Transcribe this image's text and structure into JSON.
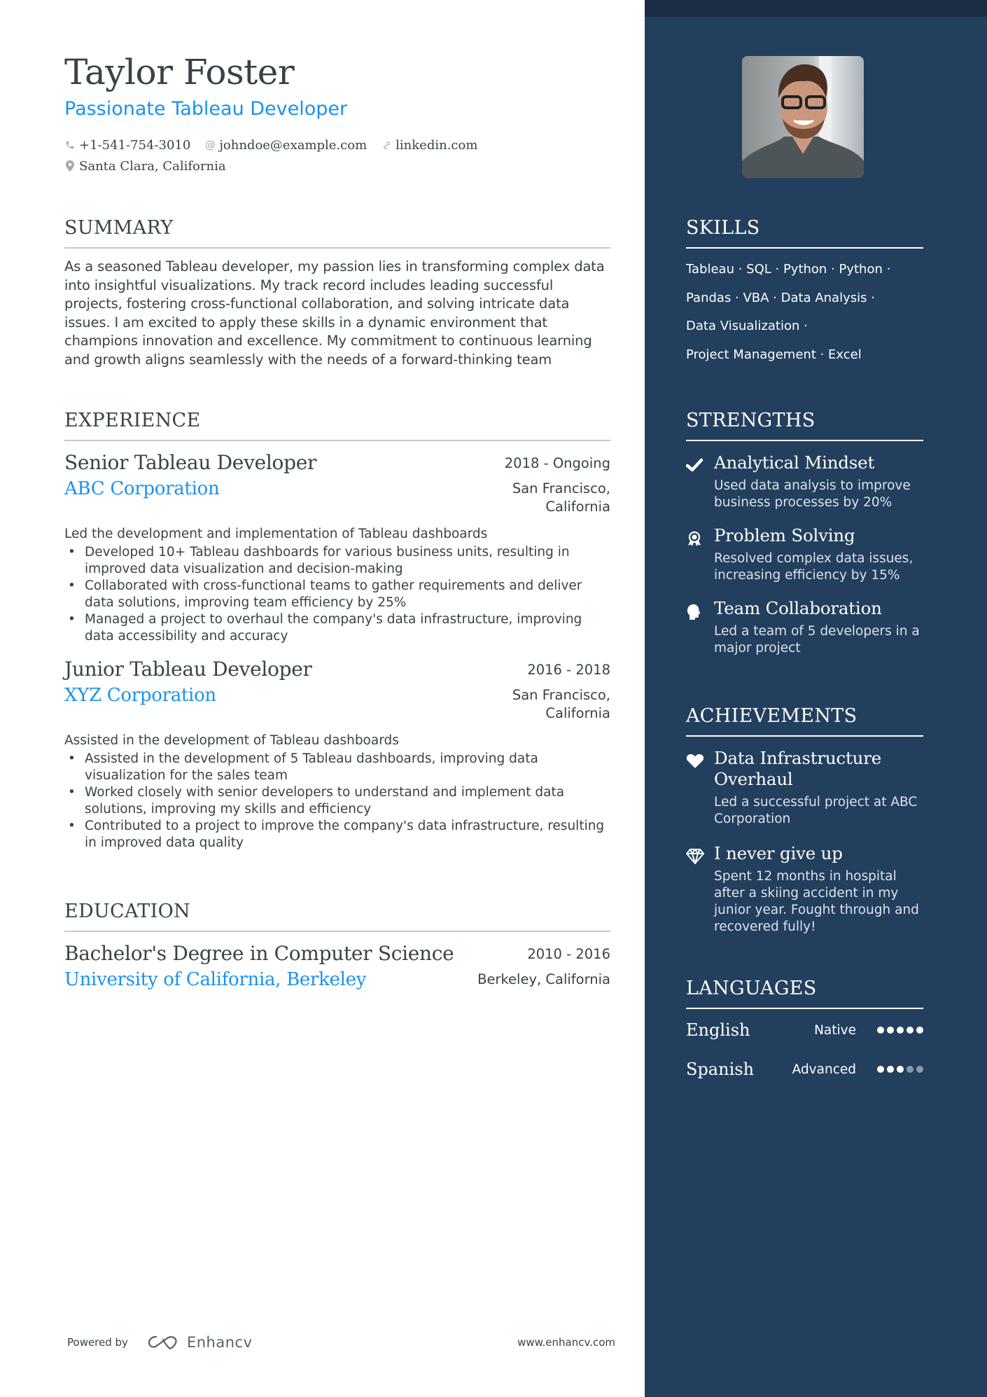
{
  "header": {
    "name": "Taylor Foster",
    "title": "Passionate Tableau Developer",
    "contacts": {
      "phone": "+1-541-754-3010",
      "email": "johndoe@example.com",
      "website": "linkedin.com",
      "location": "Santa Clara, California"
    }
  },
  "summary": {
    "heading": "SUMMARY",
    "text": "As a seasoned Tableau developer, my passion lies in transforming complex data into insightful visualizations. My track record includes leading successful projects, fostering cross-functional collaboration, and solving intricate data issues. I am excited to apply these skills in a dynamic environment that champions innovation and excellence. My commitment to continuous learning and growth aligns seamlessly with the needs of a forward-thinking team"
  },
  "experience": {
    "heading": "EXPERIENCE",
    "jobs": [
      {
        "title": "Senior Tableau Developer",
        "dates": "2018 - Ongoing",
        "company": "ABC Corporation",
        "location": "San Francisco,\nCalifornia",
        "description": "Led the development and implementation of Tableau dashboards",
        "bullets": [
          "Developed 10+ Tableau dashboards for various business units, resulting in improved data visualization and decision-making",
          "Collaborated with cross-functional teams to gather requirements and deliver data solutions, improving team efficiency by 25%",
          "Managed a project to overhaul the company's data infrastructure, improving data accessibility and accuracy"
        ]
      },
      {
        "title": "Junior Tableau Developer",
        "dates": "2016 - 2018",
        "company": "XYZ Corporation",
        "location": "San Francisco,\nCalifornia",
        "description": "Assisted in the development of Tableau dashboards",
        "bullets": [
          "Assisted in the development of 5 Tableau dashboards, improving data visualization for the sales team",
          "Worked closely with senior developers to understand and implement data solutions, improving my skills and efficiency",
          "Contributed to a project to improve the company's data infrastructure, resulting in improved data quality"
        ]
      }
    ]
  },
  "education": {
    "heading": "EDUCATION",
    "items": [
      {
        "degree": "Bachelor's Degree in Computer Science",
        "dates": "2010 - 2016",
        "school": "University of California, Berkeley",
        "location": "Berkeley, California"
      }
    ]
  },
  "footer": {
    "powered_by": "Powered by",
    "brand": "Enhancv",
    "website": "www.enhancv.com"
  },
  "sidebar": {
    "skills": {
      "heading": "SKILLS",
      "lines": [
        "Tableau · SQL · Python · Python ·",
        "Pandas · VBA · Data Analysis ·",
        "Data Visualization ·",
        "Project Management · Excel"
      ]
    },
    "strengths": {
      "heading": "STRENGTHS",
      "items": [
        {
          "icon": "check-icon",
          "title": "Analytical Mindset",
          "description": "Used data analysis to improve business processes by 20%"
        },
        {
          "icon": "award-icon",
          "title": "Problem Solving",
          "description": "Resolved complex data issues, increasing efficiency by 15%"
        },
        {
          "icon": "head-icon",
          "title": "Team Collaboration",
          "description": "Led a team of 5 developers in a major project"
        }
      ]
    },
    "achievements": {
      "heading": "ACHIEVEMENTS",
      "items": [
        {
          "icon": "heart-icon",
          "title": "Data Infrastructure Overhaul",
          "description": "Led a successful project at ABC Corporation"
        },
        {
          "icon": "diamond-icon",
          "title": "I never give up",
          "description": "Spent 12 months in hospital after a skiing accident in my junior year. Fought through and recovered fully!"
        }
      ]
    },
    "languages": {
      "heading": "LANGUAGES",
      "items": [
        {
          "name": "English",
          "level": "Native",
          "rating": 5,
          "max": 5
        },
        {
          "name": "Spanish",
          "level": "Advanced",
          "rating": 3,
          "max": 5
        }
      ]
    }
  },
  "colors": {
    "accent": "#1a91f0",
    "text": "#384347",
    "sidebar_bg": "#233f5e",
    "sidebar_top": "#1b2d44"
  }
}
